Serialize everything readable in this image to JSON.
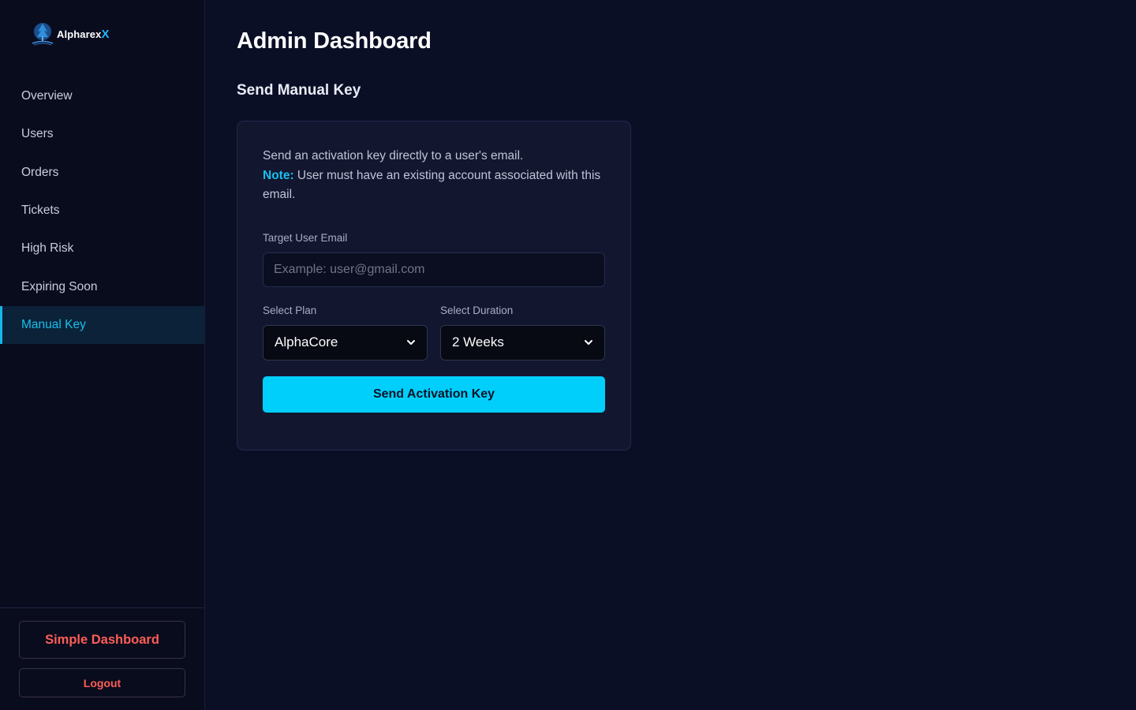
{
  "brand": {
    "name": "Alpharex",
    "suffix": "X",
    "logo_icon": "tree-globe-logo-icon",
    "accent_color": "#00cffc"
  },
  "sidebar": {
    "items": [
      {
        "label": "Overview",
        "active": false
      },
      {
        "label": "Users",
        "active": false
      },
      {
        "label": "Orders",
        "active": false
      },
      {
        "label": "Tickets",
        "active": false
      },
      {
        "label": "High Risk",
        "active": false
      },
      {
        "label": "Expiring Soon",
        "active": false
      },
      {
        "label": "Manual Key",
        "active": true
      }
    ],
    "simple_dashboard_label": "Simple Dashboard",
    "logout_label": "Logout"
  },
  "main": {
    "title": "Admin Dashboard",
    "section_title": "Send Manual Key",
    "card": {
      "description": "Send an activation key directly to a user's email.",
      "note_label": "Note:",
      "note_text": " User must have an existing account associated with this email.",
      "email_label": "Target User Email",
      "email_placeholder": "Example: user@gmail.com",
      "email_value": "",
      "plan_label": "Select Plan",
      "plan_value": "AlphaCore",
      "duration_label": "Select Duration",
      "duration_value": "2 Weeks",
      "submit_label": "Send Activation Key"
    }
  }
}
